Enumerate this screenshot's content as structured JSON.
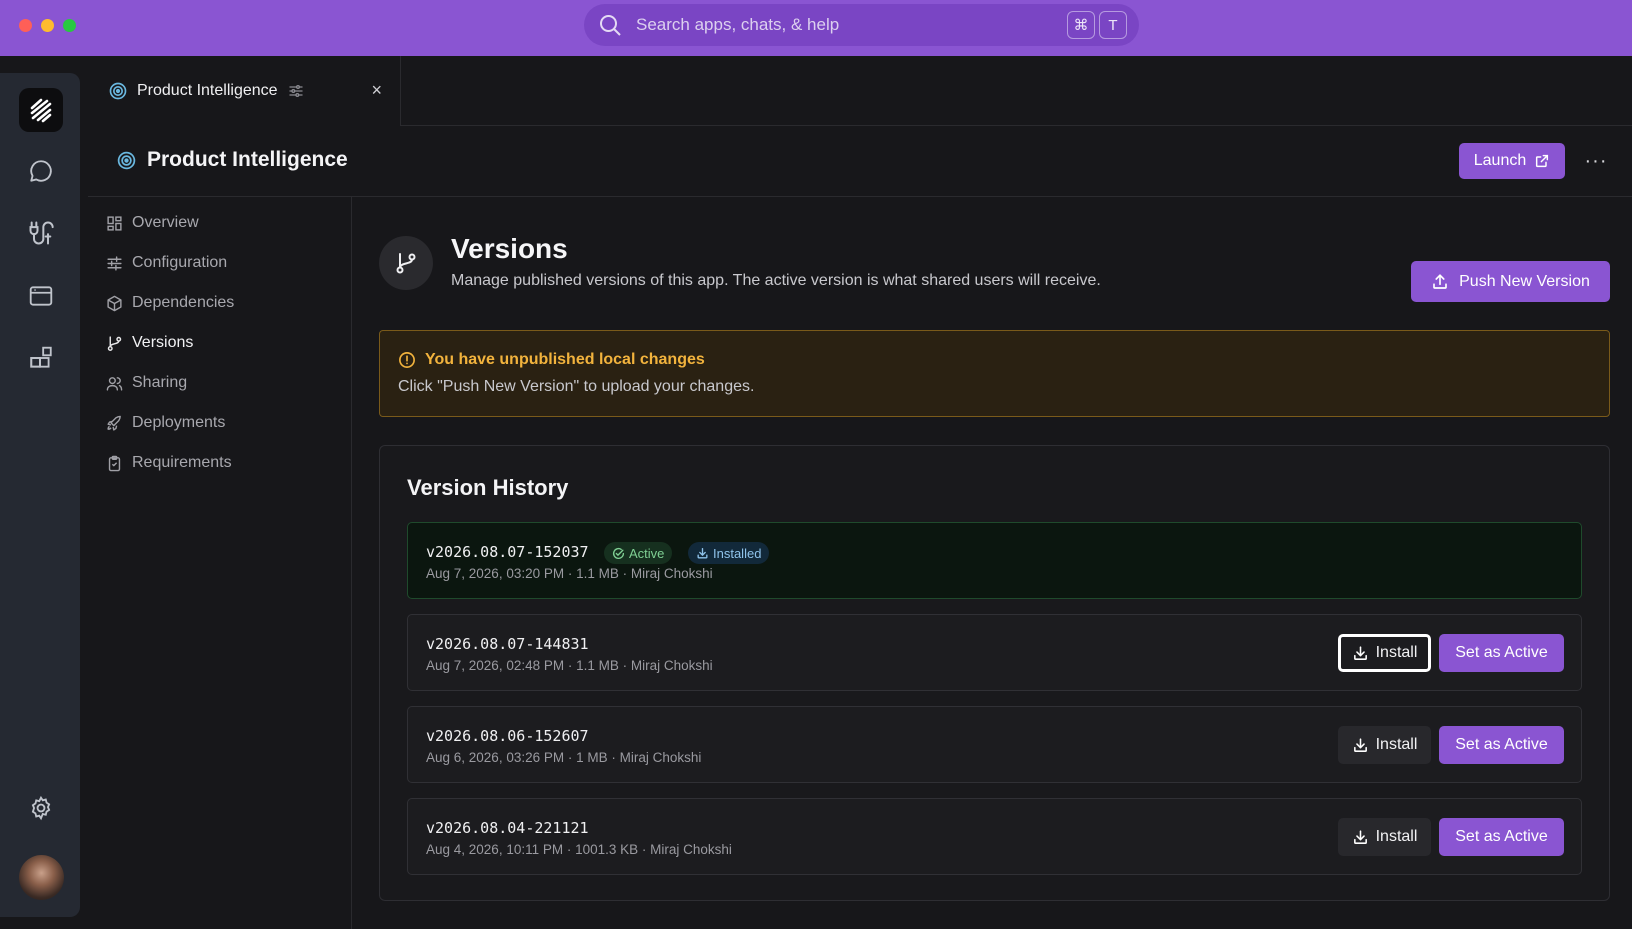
{
  "search": {
    "placeholder": "Search apps, chats, & help",
    "key1": "⌘",
    "key2": "T"
  },
  "tab": {
    "label": "Product Intelligence",
    "close": "×"
  },
  "header": {
    "title": "Product Intelligence",
    "launch_label": "Launch",
    "more": "···"
  },
  "nav": [
    {
      "label": "Overview",
      "icon": "grid-icon"
    },
    {
      "label": "Configuration",
      "icon": "sliders-icon"
    },
    {
      "label": "Dependencies",
      "icon": "package-icon"
    },
    {
      "label": "Versions",
      "icon": "git-branch-icon",
      "active": true
    },
    {
      "label": "Sharing",
      "icon": "users-icon"
    },
    {
      "label": "Deployments",
      "icon": "rocket-icon"
    },
    {
      "label": "Requirements",
      "icon": "clipboard-icon"
    }
  ],
  "versions": {
    "title": "Versions",
    "subtitle": "Manage published versions of this app. The active version is what shared users will receive.",
    "push_label": "Push New Version"
  },
  "warning": {
    "title": "You have unpublished local changes",
    "body": "Click \"Push New Version\" to upload your changes."
  },
  "history": {
    "title": "Version History",
    "install_label": "Install",
    "set_active_label": "Set as Active",
    "active_badge": "Active",
    "installed_badge": "Installed",
    "rows": [
      {
        "version": "v2026.08.07-152037",
        "meta": "Aug 7, 2026, 03:20 PM · 1.1 MB · Miraj Chokshi",
        "active": true
      },
      {
        "version": "v2026.08.07-144831",
        "meta": "Aug 7, 2026, 02:48 PM · 1.1 MB · Miraj Chokshi"
      },
      {
        "version": "v2026.08.06-152607",
        "meta": "Aug 6, 2026, 03:26 PM · 1 MB · Miraj Chokshi"
      },
      {
        "version": "v2026.08.04-221121",
        "meta": "Aug 4, 2026, 10:11 PM · 1001.3 KB · Miraj Chokshi"
      }
    ]
  },
  "colors": {
    "accent": "#8a55d2",
    "warning": "#f2b33d",
    "success": "#7fcf93"
  }
}
